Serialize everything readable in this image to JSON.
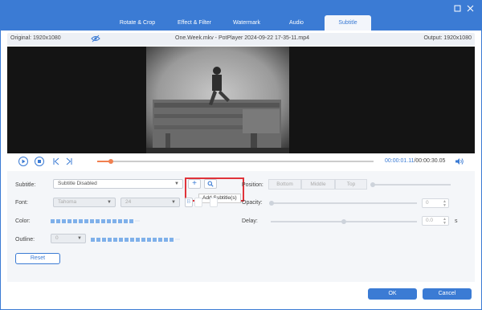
{
  "window": {
    "tabs": [
      {
        "label": "Rotate & Crop"
      },
      {
        "label": "Effect & Filter"
      },
      {
        "label": "Watermark"
      },
      {
        "label": "Audio"
      },
      {
        "label": "Subtitle",
        "active": true
      }
    ],
    "restore_icon": "restore-icon",
    "close_icon": "close-icon"
  },
  "infobar": {
    "original": "Original: 1920x1080",
    "filename": "One.Week.mkv - PotPlayer 2024-09-22 17-35-11.mp4",
    "output": "Output: 1920x1080"
  },
  "playback": {
    "current_time": "00:00:01.11",
    "total_time": "/00:00:30.05",
    "progress": 0.05
  },
  "subtitle": {
    "label": "Subtitle:",
    "value": "Subtitle Disabled",
    "add_tooltip": "Add Subtitle(s)"
  },
  "font": {
    "label": "Font:",
    "family": "Tahoma",
    "size": "24"
  },
  "color": {
    "label": "Color:"
  },
  "outline": {
    "label": "Outline:",
    "value": "0"
  },
  "reset_label": "Reset",
  "position": {
    "label": "Position:",
    "options": [
      "Bottom",
      "Middle",
      "Top"
    ]
  },
  "opacity": {
    "label": "Opacity:",
    "value": "0"
  },
  "delay": {
    "label": "Delay:",
    "value": "0.0",
    "unit": "s"
  },
  "footer": {
    "ok_label": "OK",
    "cancel_label": "Cancel"
  },
  "colors": {
    "accent": "#3b7bd4",
    "highlight": "#e0333a",
    "progress": "#f08050"
  }
}
